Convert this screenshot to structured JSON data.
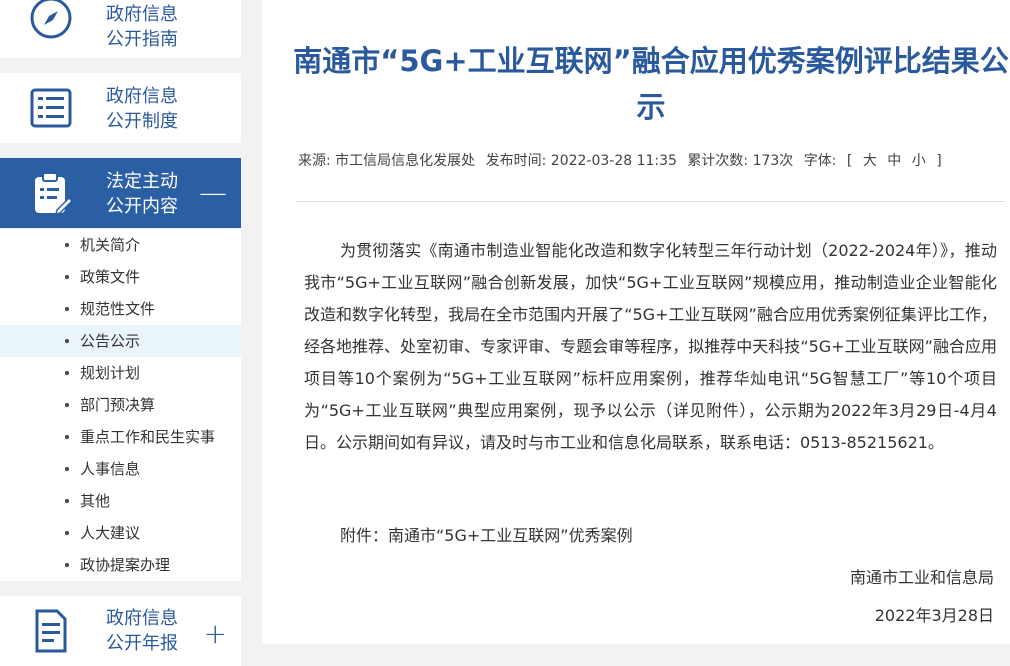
{
  "sidebar": {
    "cards": [
      {
        "label": "政府信息\n公开指南",
        "icon": "compass-icon"
      },
      {
        "label": "政府信息\n公开制度",
        "icon": "list-icon"
      },
      {
        "label": "法定主动\n公开内容",
        "icon": "clipboard-icon",
        "toggle": "—"
      },
      {
        "label": "政府信息\n公开年报",
        "icon": "document-icon",
        "toggle": "+"
      }
    ],
    "sub_items": [
      "机关简介",
      "政策文件",
      "规范性文件",
      "公告公示",
      "规划计划",
      "部门预决算",
      "重点工作和民生实事",
      "人事信息",
      "其他",
      "人大建议",
      "政协提案办理"
    ],
    "current_sub_item": "公告公示",
    "colors": {
      "accent": "#2b5fa3",
      "highlight": "#eaf4fb"
    }
  },
  "article": {
    "title": "南通市“5G+工业互联网”融合应用优秀案例评比结果公示",
    "meta": {
      "source": "来源: 市工信局信息化发展处",
      "published": "发布时间:  2022-03-28 11:35",
      "views": "累计次数:   173次",
      "font_label": "字体:",
      "size_open": "[",
      "size_large": "大",
      "size_medium": "中",
      "size_small": "小",
      "size_close": "]"
    },
    "body": "为贯彻落实《南通市制造业智能化改造和数字化转型三年行动计划（2022-2024年）》，推动我市“5G+工业互联网”融合创新发展，加快“5G+工业互联网”规模应用，推动制造业企业智能化改造和数字化转型，我局在全市范围内开展了“5G+工业互联网”融合应用优秀案例征集评比工作，经各地推荐、处室初审、专家评审、专题会审等程序，拟推荐中天科技“5G+工业互联网”融合应用项目等10个案例为“5G+工业互联网”标杆应用案例，推荐华灿电讯“5G智慧工厂”等10个项目为“5G+工业互联网”典型应用案例，现予以公示（详见附件），公示期为2022年3月29日-4月4日。公示期间如有异议，请及时与市工业和信息化局联系，联系电话：0513-85215621。",
    "attachment": "附件：南通市“5G+工业互联网”优秀案例",
    "signature": "南通市工业和信息局",
    "date": "2022年3月28日"
  }
}
